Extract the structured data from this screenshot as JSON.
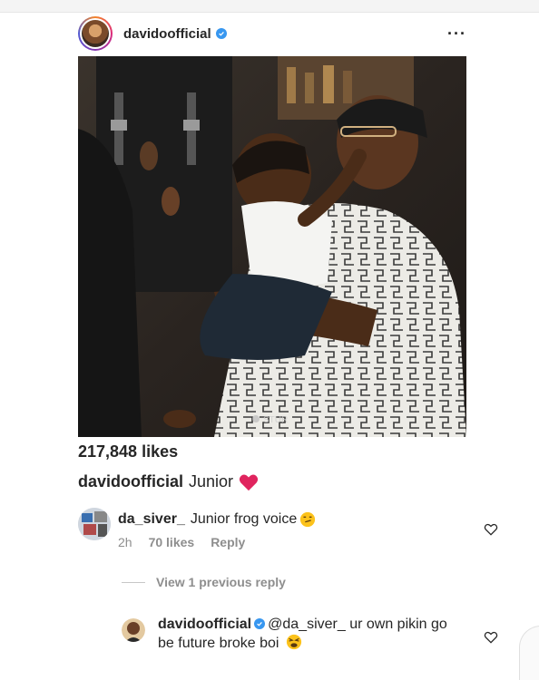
{
  "post": {
    "username": "davidoofficial",
    "verified": true,
    "more_icon": "more-dots-icon",
    "photo_watermark": "STUR",
    "likes": "217,848 likes",
    "caption_username": "davidoofficial",
    "caption_text": "Junior"
  },
  "comment": {
    "username": "da_siver_",
    "text": "Junior frog voice",
    "time": "2h",
    "likes": "70 likes",
    "reply_label": "Reply"
  },
  "view_replies": "View 1 previous reply",
  "reply": {
    "username": "davidoofficial",
    "mention": "@da_siver_",
    "text": " ur own pikin go be future broke boi"
  },
  "colors": {
    "verified": "#3897f0",
    "muted": "#8e8e8e",
    "text": "#262626",
    "heart": "#e0245e"
  }
}
